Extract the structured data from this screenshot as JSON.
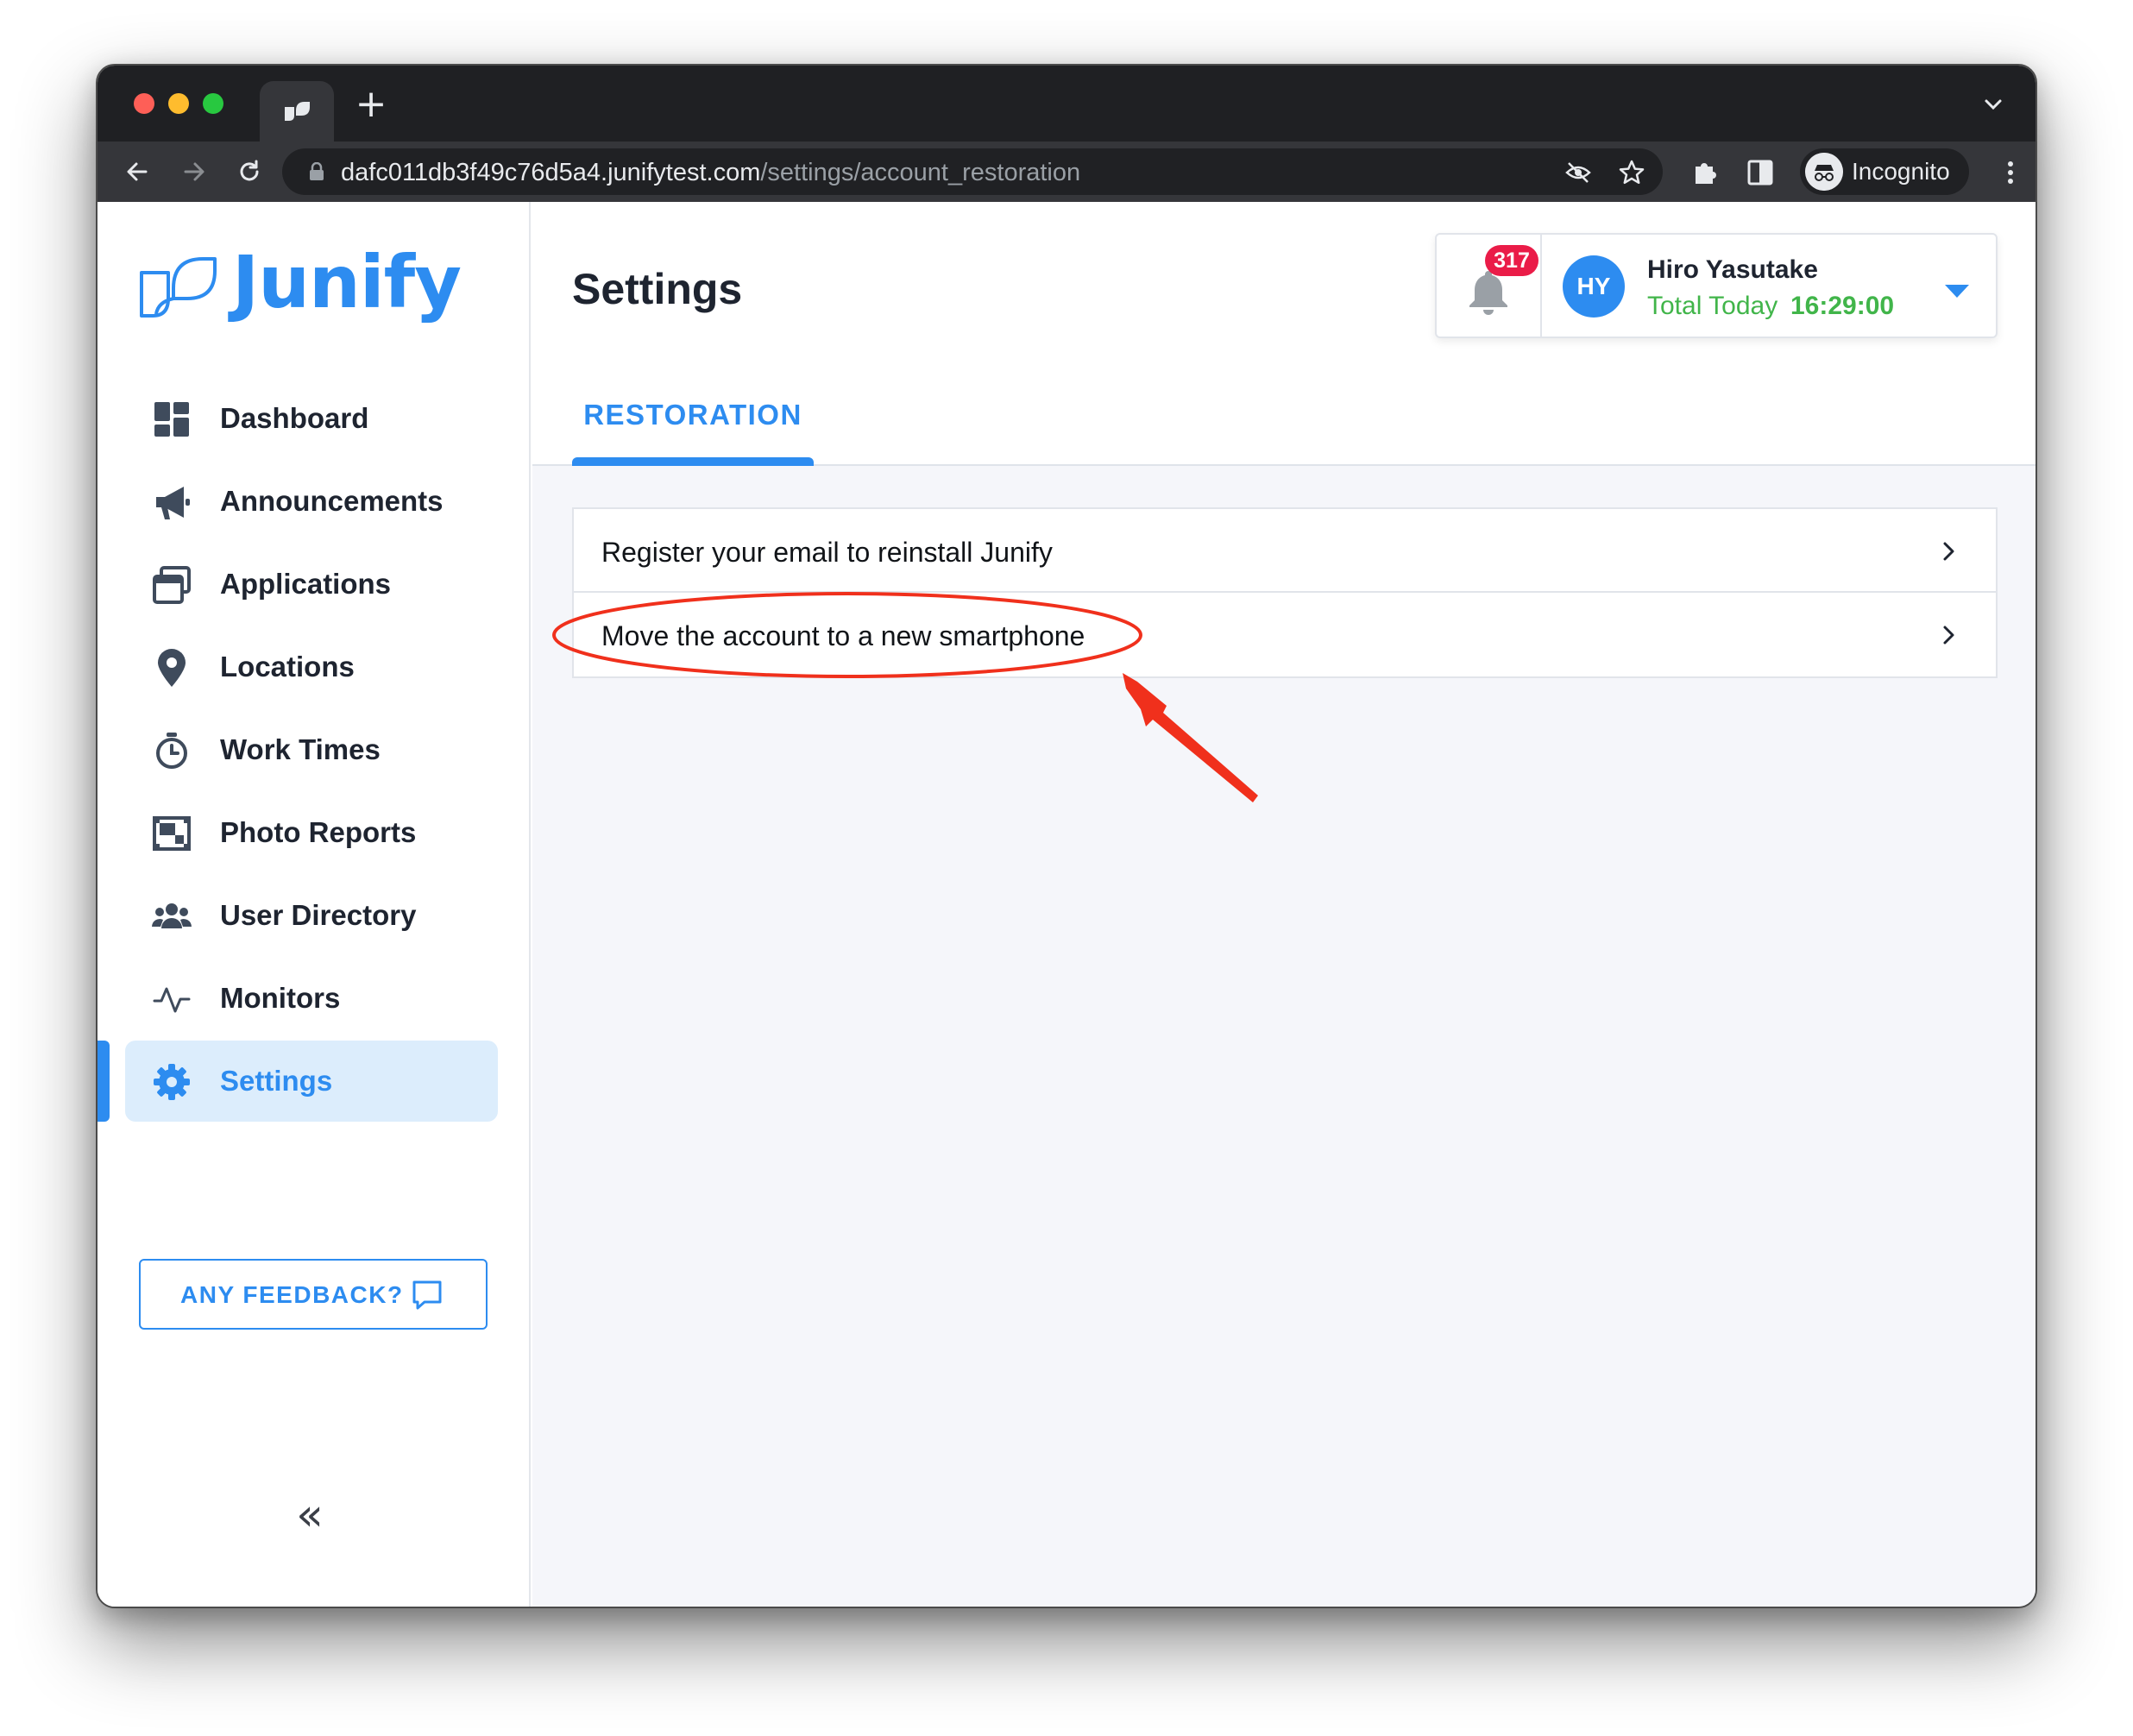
{
  "browser": {
    "url_host": "dafc011db3f49c76d5a4.junifytest.com",
    "url_path": "/settings/account_restoration",
    "incognito_label": "Incognito",
    "new_tab_label": "+"
  },
  "brand": {
    "name": "Junify",
    "color": "#2d8cf0"
  },
  "sidebar": {
    "items": [
      {
        "label": "Dashboard",
        "icon": "dashboard-icon"
      },
      {
        "label": "Announcements",
        "icon": "megaphone-icon"
      },
      {
        "label": "Applications",
        "icon": "windows-icon"
      },
      {
        "label": "Locations",
        "icon": "map-pin-icon"
      },
      {
        "label": "Work Times",
        "icon": "stopwatch-icon"
      },
      {
        "label": "Photo Reports",
        "icon": "photo-frame-icon"
      },
      {
        "label": "User Directory",
        "icon": "users-icon"
      },
      {
        "label": "Monitors",
        "icon": "pulse-icon"
      },
      {
        "label": "Settings",
        "icon": "gear-icon",
        "active": true
      }
    ],
    "feedback_label": "ANY FEEDBACK?",
    "collapse_label": "«"
  },
  "header": {
    "title": "Settings",
    "tab_label": "RESTORATION",
    "notifications_count": "317",
    "user": {
      "initials": "HY",
      "name": "Hiro Yasutake",
      "total_label": "Total Today",
      "total_value": "16:29:00"
    }
  },
  "restoration": {
    "options": [
      {
        "label": "Register your email to reinstall Junify"
      },
      {
        "label": "Move the account to a new smartphone",
        "highlighted": true
      }
    ]
  },
  "colors": {
    "accent": "#2d8cf0",
    "badge": "#ea1c48",
    "time_green": "#41b54a",
    "annotation_red": "#f0301c",
    "active_nav_bg": "#dcedfc"
  }
}
